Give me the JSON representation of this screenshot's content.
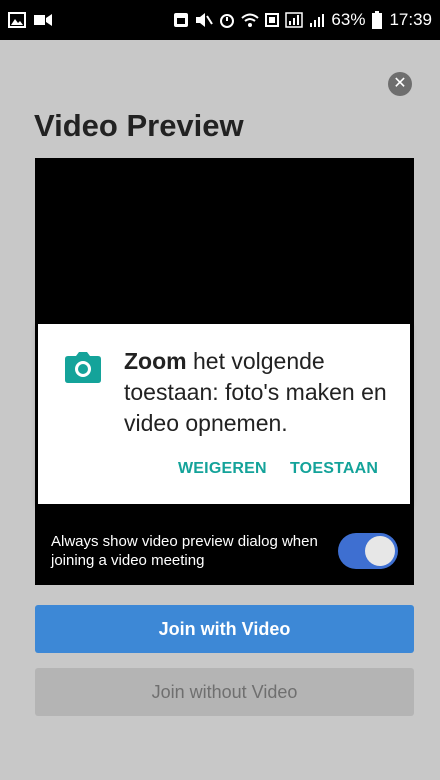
{
  "status_bar": {
    "battery": "63%",
    "time": "17:39",
    "icons": [
      "gallery-icon",
      "video-camera-icon",
      "sim-icon",
      "mute-icon",
      "alarm-icon",
      "wifi-icon",
      "cast-icon",
      "network-icon",
      "signal-icon",
      "battery-icon"
    ]
  },
  "header": {
    "title": "Video Preview",
    "close_icon": "close-icon"
  },
  "preview": {
    "always_show_text": "Always show video preview dialog when joining a video meeting",
    "toggle_on": true,
    "toggle_color": "#3e6fd1"
  },
  "permission_dialog": {
    "app_name": "Zoom",
    "message": " het volgende toestaan: foto's maken en video opnemen.",
    "deny_label": "WEIGEREN",
    "allow_label": "TOESTAAN",
    "icon": "camera-icon",
    "accent_color": "#14a39a"
  },
  "buttons": {
    "join_with_video": "Join with Video",
    "join_without_video": "Join without Video"
  }
}
